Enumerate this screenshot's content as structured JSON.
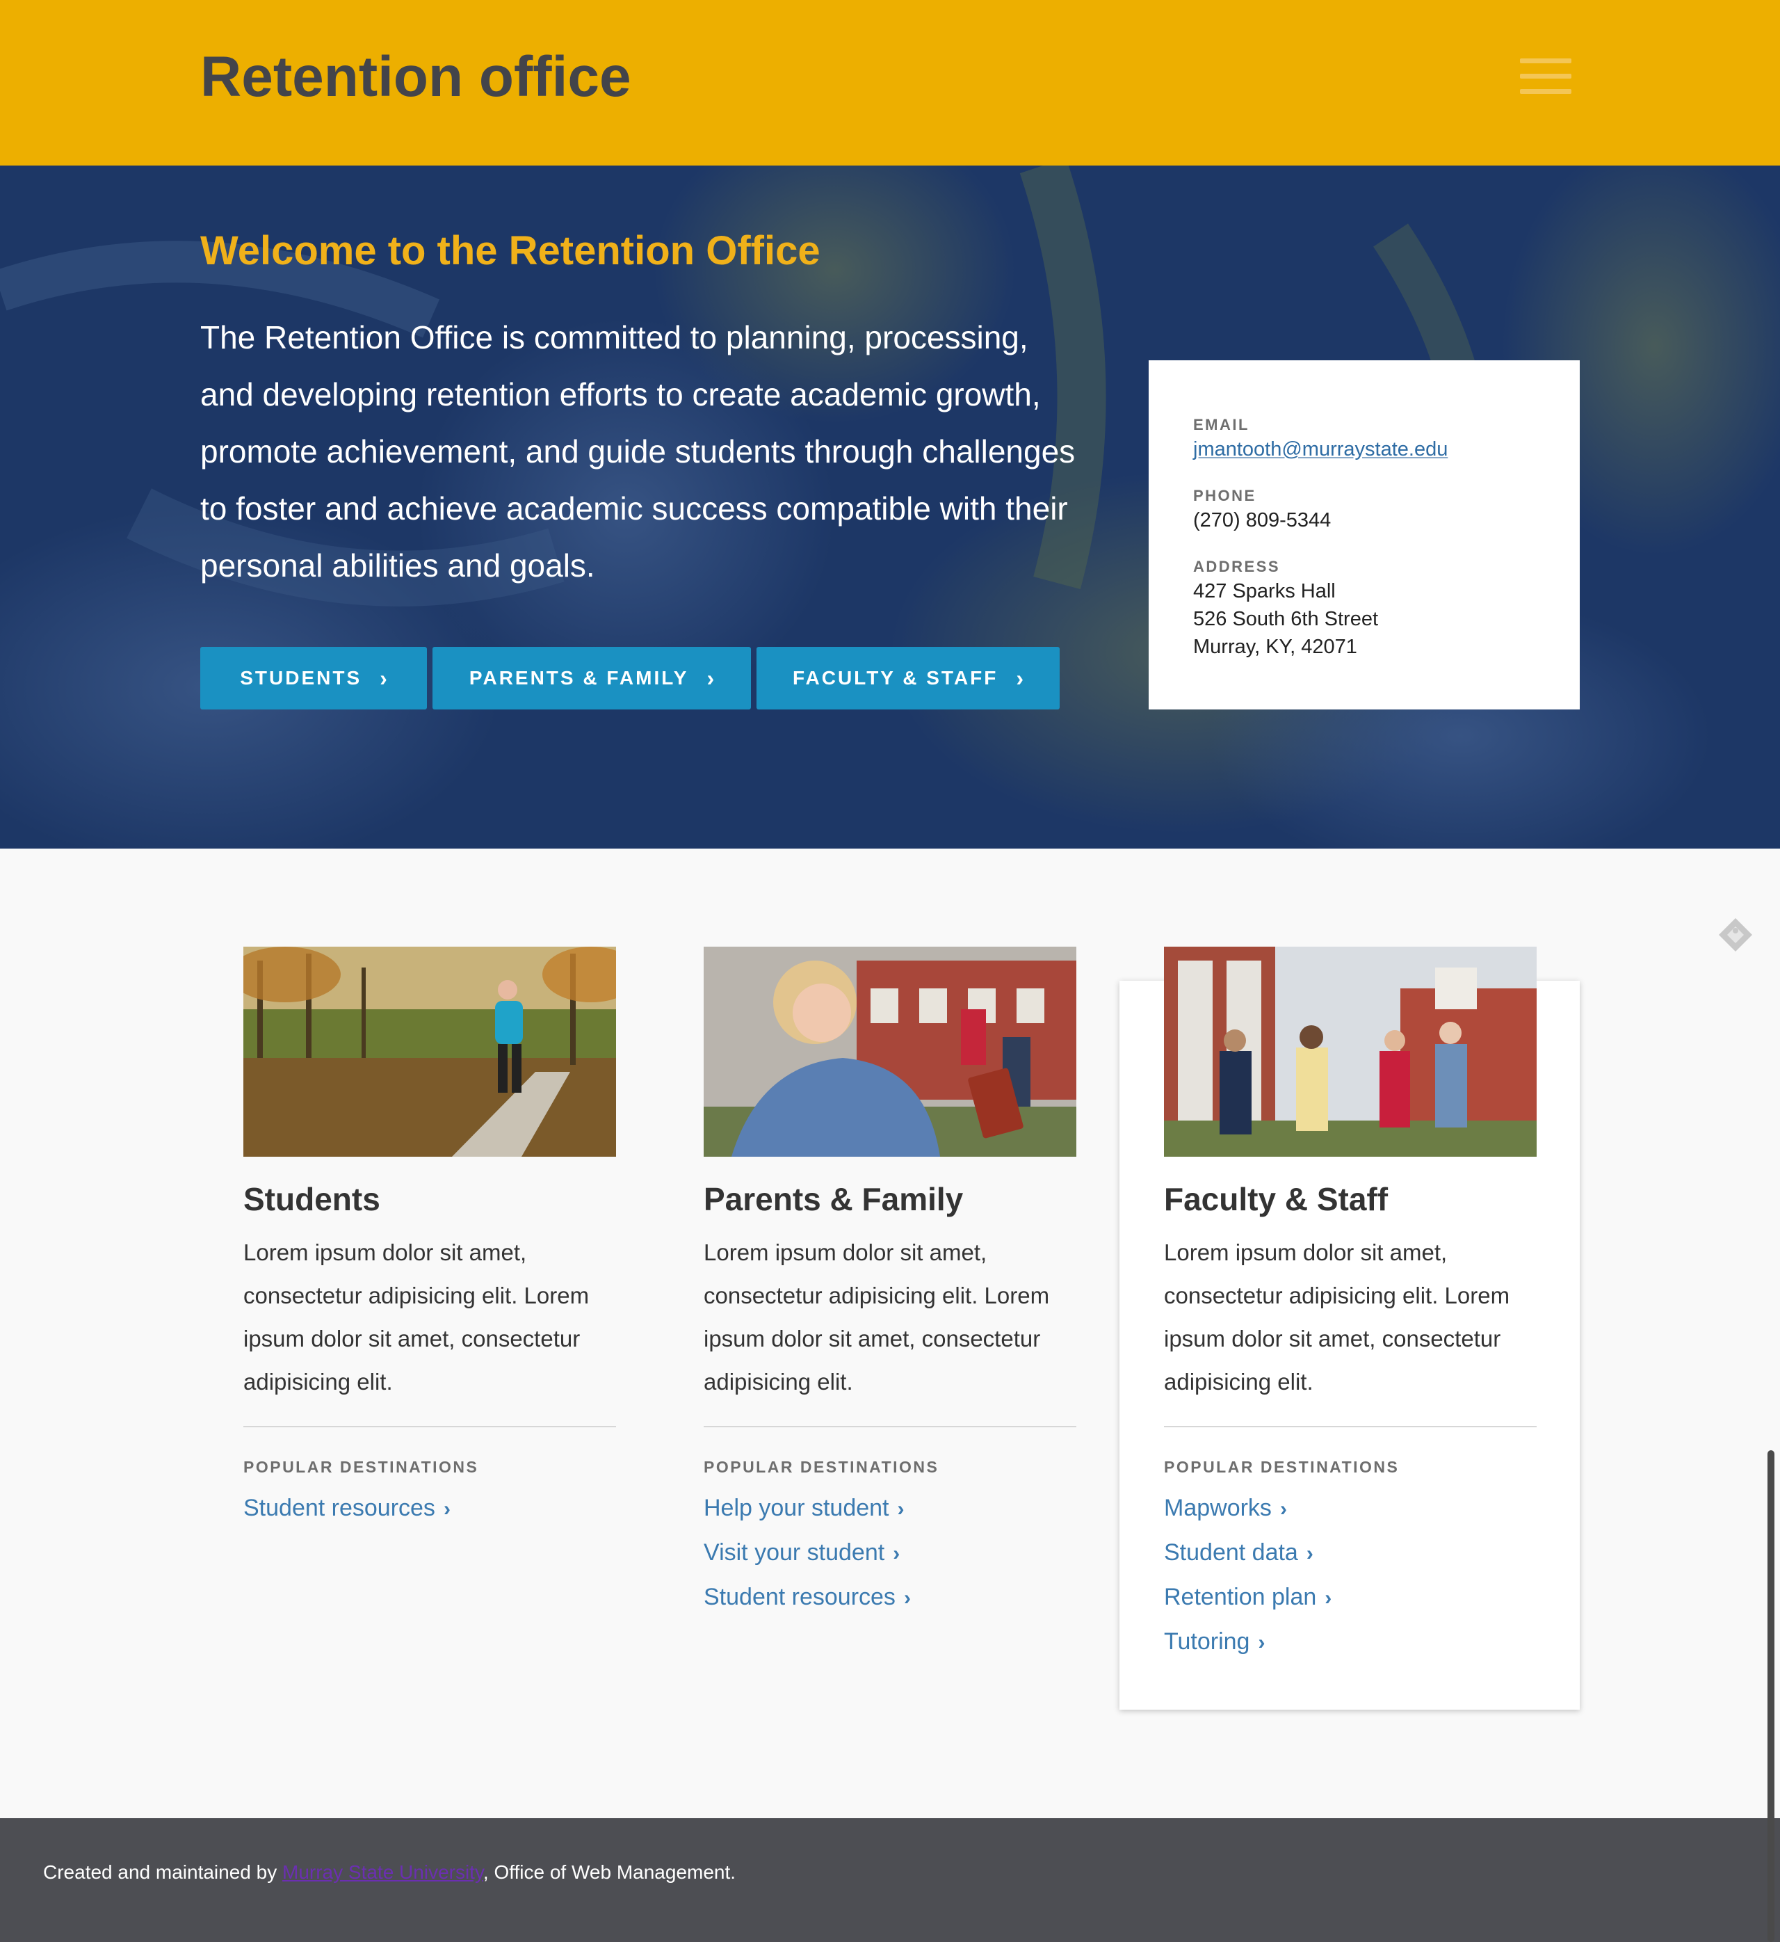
{
  "header": {
    "site_title": "Retention office",
    "menu_icon": "hamburger-menu-icon"
  },
  "hero": {
    "title": "Welcome to the Retention Office",
    "text": "The Retention Office is committed to planning, processing, and developing retention efforts to create academic growth, promote achievement, and guide students through challenges to foster and achieve academic success compatible with their personal abilities and goals.",
    "buttons": [
      {
        "label": "STUDENTS",
        "chevron": "›"
      },
      {
        "label": "PARENTS & FAMILY",
        "chevron": "›"
      },
      {
        "label": "FACULTY & STAFF",
        "chevron": "›"
      }
    ]
  },
  "contact": {
    "email_label": "EMAIL",
    "email": "jmantooth@murraystate.edu",
    "phone_label": "PHONE",
    "phone": "(270) 809-5344",
    "address_label": "ADDRESS",
    "address_line1": "427 Sparks Hall",
    "address_line2": "526 South 6th Street",
    "address_line3": "Murray, KY, 42071"
  },
  "cards": [
    {
      "title": "Students",
      "body": "Lorem ipsum dolor sit amet, consectetur adipisicing elit. Lorem ipsum dolor sit amet, consectetur adipisicing elit.",
      "popular_label": "POPULAR DESTINATIONS",
      "links": [
        "Student resources"
      ]
    },
    {
      "title": "Parents & Family",
      "body": "Lorem ipsum dolor sit amet, consectetur adipisicing elit. Lorem ipsum dolor sit amet, consectetur adipisicing elit.",
      "popular_label": "POPULAR DESTINATIONS",
      "links": [
        "Help your student",
        "Visit your student",
        "Student resources"
      ]
    },
    {
      "title": "Faculty & Staff",
      "body": "Lorem ipsum dolor sit amet, consectetur adipisicing elit. Lorem ipsum dolor sit amet, consectetur adipisicing elit.",
      "popular_label": "POPULAR DESTINATIONS",
      "links": [
        "Mapworks",
        "Student data",
        "Retention plan",
        "Tutoring"
      ]
    }
  ],
  "link_chevron": "›",
  "footer": {
    "prefix": "Created and maintained by ",
    "link": "Murray State University",
    "suffix": ", Office of Web Management."
  },
  "colors": {
    "header_bg": "#edaf00",
    "hero_overlay": "#1b3463",
    "hero_title": "#f0b11a",
    "button_bg": "#1a91c2",
    "link": "#3b7ab0",
    "footer_bg": "#4d4e53"
  }
}
